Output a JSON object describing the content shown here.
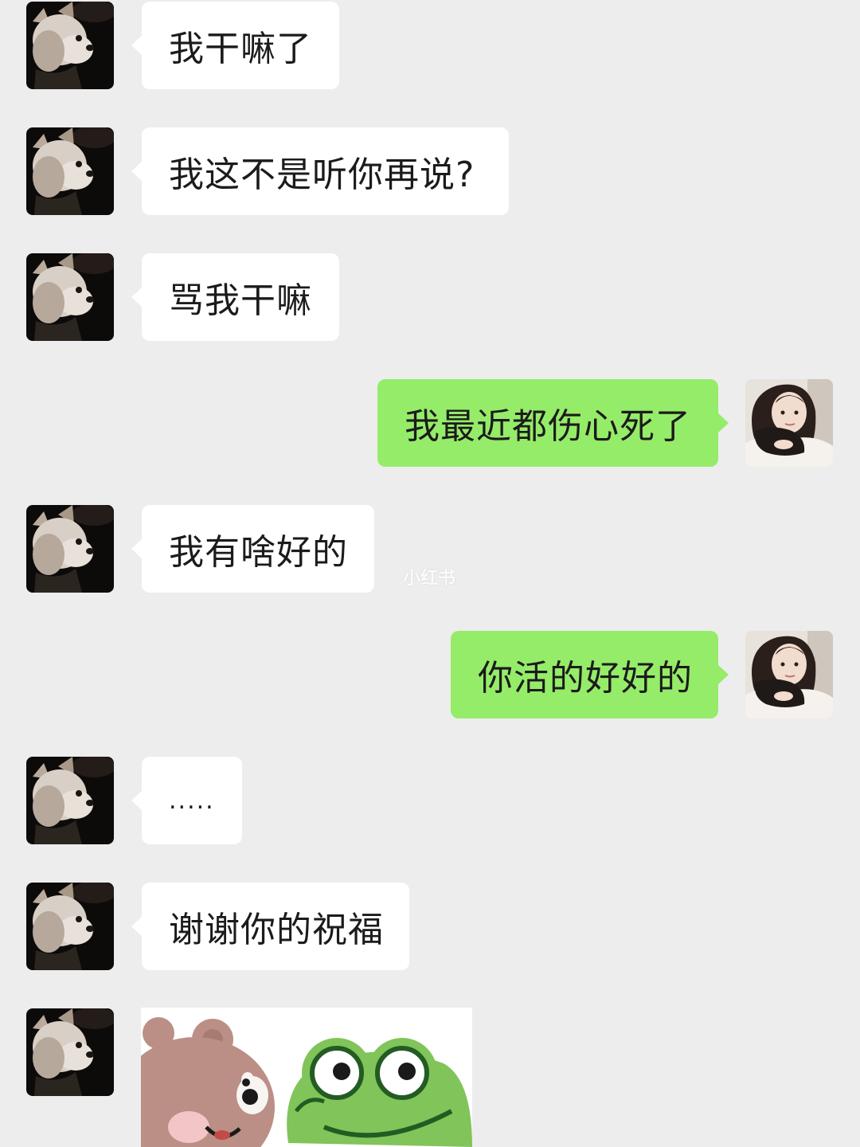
{
  "conversation": {
    "messages": [
      {
        "sender": "them",
        "text": "我干嘛了"
      },
      {
        "sender": "them",
        "text": "我这不是听你再说?"
      },
      {
        "sender": "them",
        "text": "骂我干嘛"
      },
      {
        "sender": "me",
        "text": "我最近都伤心死了"
      },
      {
        "sender": "them",
        "text": "我有啥好的"
      },
      {
        "sender": "me",
        "text": "你活的好好的"
      },
      {
        "sender": "them",
        "text": "....."
      },
      {
        "sender": "them",
        "text": "谢谢你的祝福"
      },
      {
        "sender": "them",
        "type": "sticker",
        "sticker": "bear-and-frog-sticker"
      }
    ]
  },
  "watermark": "小红书",
  "colors": {
    "background": "#ededed",
    "incoming_bubble": "#ffffff",
    "outgoing_bubble": "#95ec69",
    "text": "#1b1b1b"
  },
  "icons": {
    "contact_avatar": "dog-avatar",
    "self_avatar": "woman-hugging-dog-avatar"
  }
}
